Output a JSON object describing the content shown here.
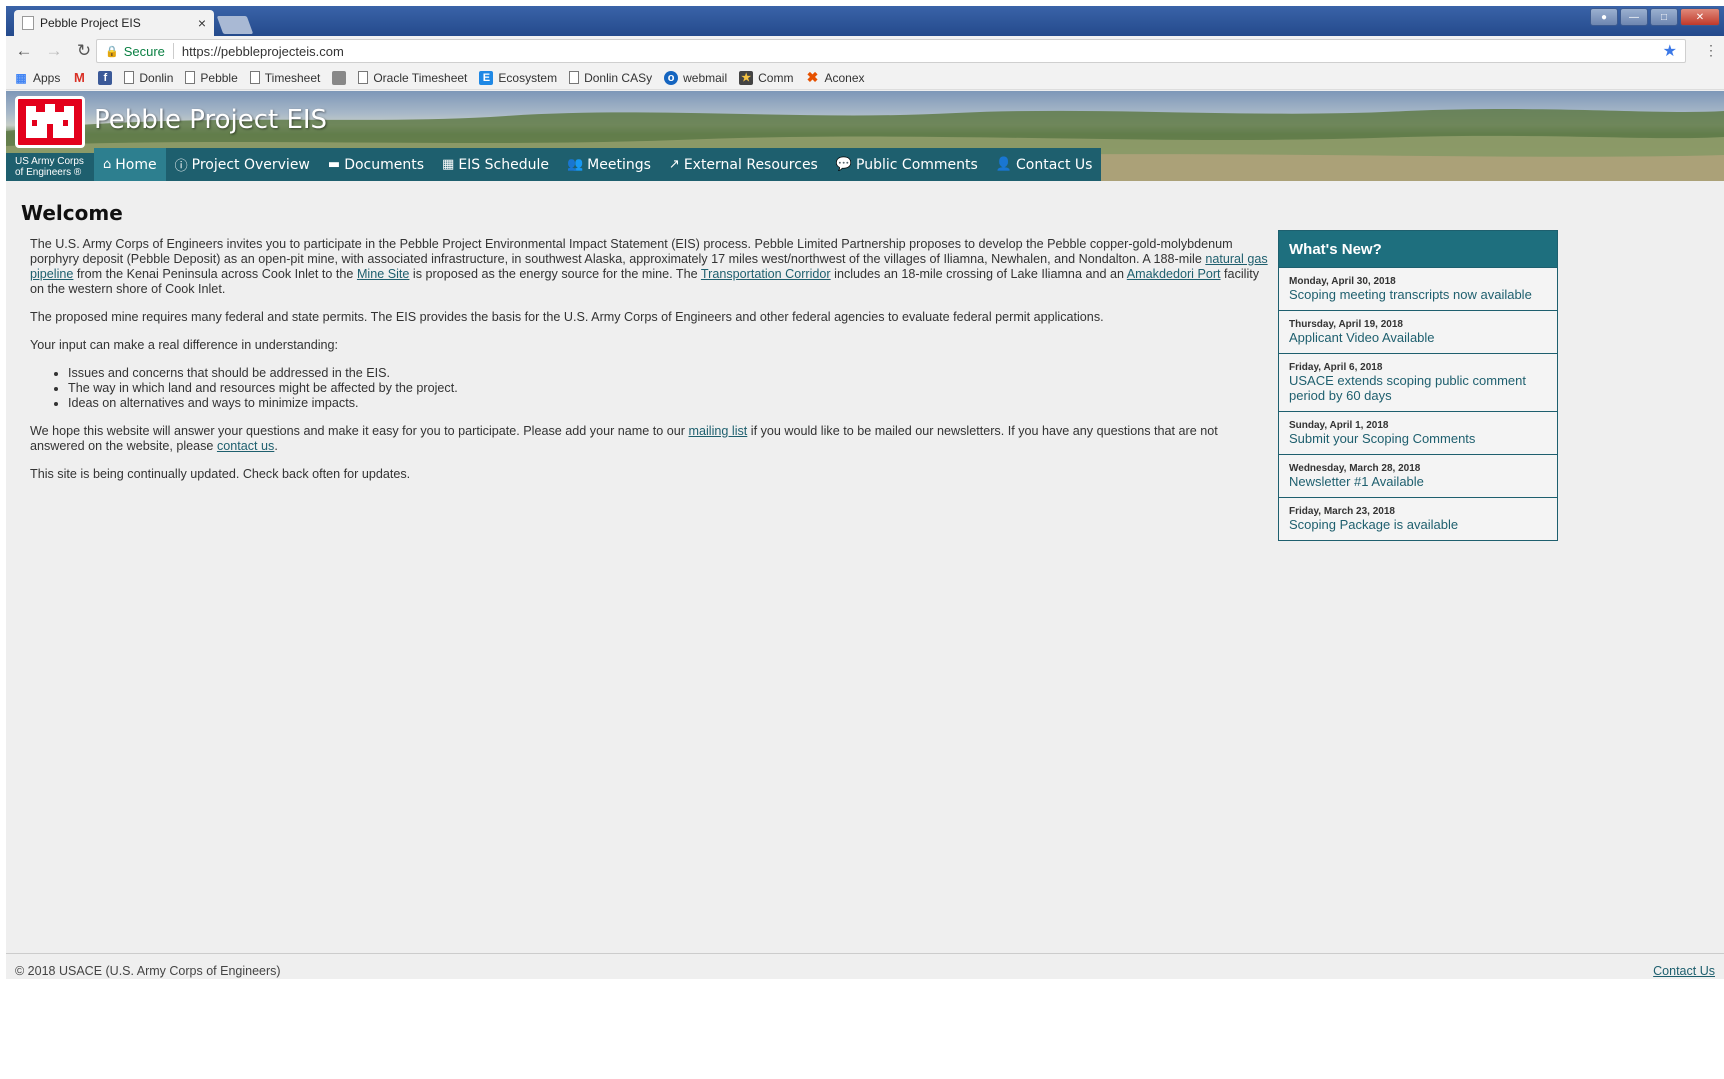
{
  "browser": {
    "tab_title": "Pebble Project EIS",
    "tab_close": "×",
    "secure_label": "Secure",
    "url": "https://pebbleprojecteis.com",
    "bookmarks": [
      "Apps",
      "Donlin",
      "Pebble",
      "Timesheet",
      "Oracle Timesheet",
      "Ecosystem",
      "Donlin CASy",
      "webmail",
      "Comm",
      "Aconex"
    ]
  },
  "site": {
    "title": "Pebble Project EIS",
    "org_line1": "US Army Corps",
    "org_line2": "of Engineers ®",
    "nav": [
      {
        "label": "Home",
        "icon": "home-icon",
        "glyph": "⌂"
      },
      {
        "label": "Project Overview",
        "icon": "info-icon",
        "glyph": "ⓘ"
      },
      {
        "label": "Documents",
        "icon": "document-icon",
        "glyph": "▬"
      },
      {
        "label": "EIS Schedule",
        "icon": "calendar-icon",
        "glyph": "▦"
      },
      {
        "label": "Meetings",
        "icon": "users-icon",
        "glyph": "👥"
      },
      {
        "label": "External Resources",
        "icon": "external-link-icon",
        "glyph": "↗"
      },
      {
        "label": "Public Comments",
        "icon": "comment-icon",
        "glyph": "💬"
      },
      {
        "label": "Contact Us",
        "icon": "user-icon",
        "glyph": "👤"
      }
    ],
    "brand_color": "#1e5f6e",
    "logo_color": "#e3001b"
  },
  "main": {
    "heading": "Welcome",
    "p1_a": "The U.S. Army Corps of Engineers invites you to participate in the Pebble Project Environmental Impact Statement (EIS) process. Pebble Limited Partnership proposes to develop the Pebble copper-gold-molybdenum porphyry deposit (Pebble Deposit) as an open-pit mine, with associated infrastructure, in southwest Alaska, approximately 17 miles west/northwest of the villages of Iliamna, Newhalen, and Nondalton. A 188-mile ",
    "p1_link1": "natural gas pipeline",
    "p1_b": " from the Kenai Peninsula across Cook Inlet to the ",
    "p1_link2": "Mine Site",
    "p1_c": " is proposed as the energy source for the mine. The ",
    "p1_link3": "Transportation Corridor",
    "p1_d": " includes an 18-mile crossing of Lake Iliamna and an ",
    "p1_link4": "Amakdedori Port",
    "p1_e": " facility on the western shore of Cook Inlet.",
    "p2": "The proposed mine requires many federal and state permits. The EIS provides the basis for the U.S. Army Corps of Engineers and other federal agencies to evaluate federal permit applications.",
    "p3": "Your input can make a real difference in understanding:",
    "bullets": [
      "Issues and concerns that should be addressed in the EIS.",
      "The way in which land and resources might be affected by the project.",
      "Ideas on alternatives and ways to minimize impacts."
    ],
    "p4_a": "We hope this website will answer your questions and make it easy for you to participate. Please add your name to our ",
    "p4_link1": "mailing list",
    "p4_b": " if you would like to be mailed our newsletters. If you have any questions that are not answered on the website, please ",
    "p4_link2": "contact us",
    "p4_c": ".",
    "p5": "This site is being continually updated. Check back often for updates."
  },
  "whats_new": {
    "heading": "What's New?",
    "items": [
      {
        "date": "Monday, April 30, 2018",
        "title": "Scoping meeting transcripts now available"
      },
      {
        "date": "Thursday, April 19, 2018",
        "title": "Applicant Video Available"
      },
      {
        "date": "Friday, April 6, 2018",
        "title": "USACE extends scoping public comment period by 60 days"
      },
      {
        "date": "Sunday, April 1, 2018",
        "title": "Submit your Scoping Comments"
      },
      {
        "date": "Wednesday, March 28, 2018",
        "title": "Newsletter #1 Available"
      },
      {
        "date": "Friday, March 23, 2018",
        "title": "Scoping Package is available"
      }
    ]
  },
  "footer": {
    "copyright": "© 2018 USACE (U.S. Army Corps of Engineers)",
    "contact": "Contact Us"
  }
}
